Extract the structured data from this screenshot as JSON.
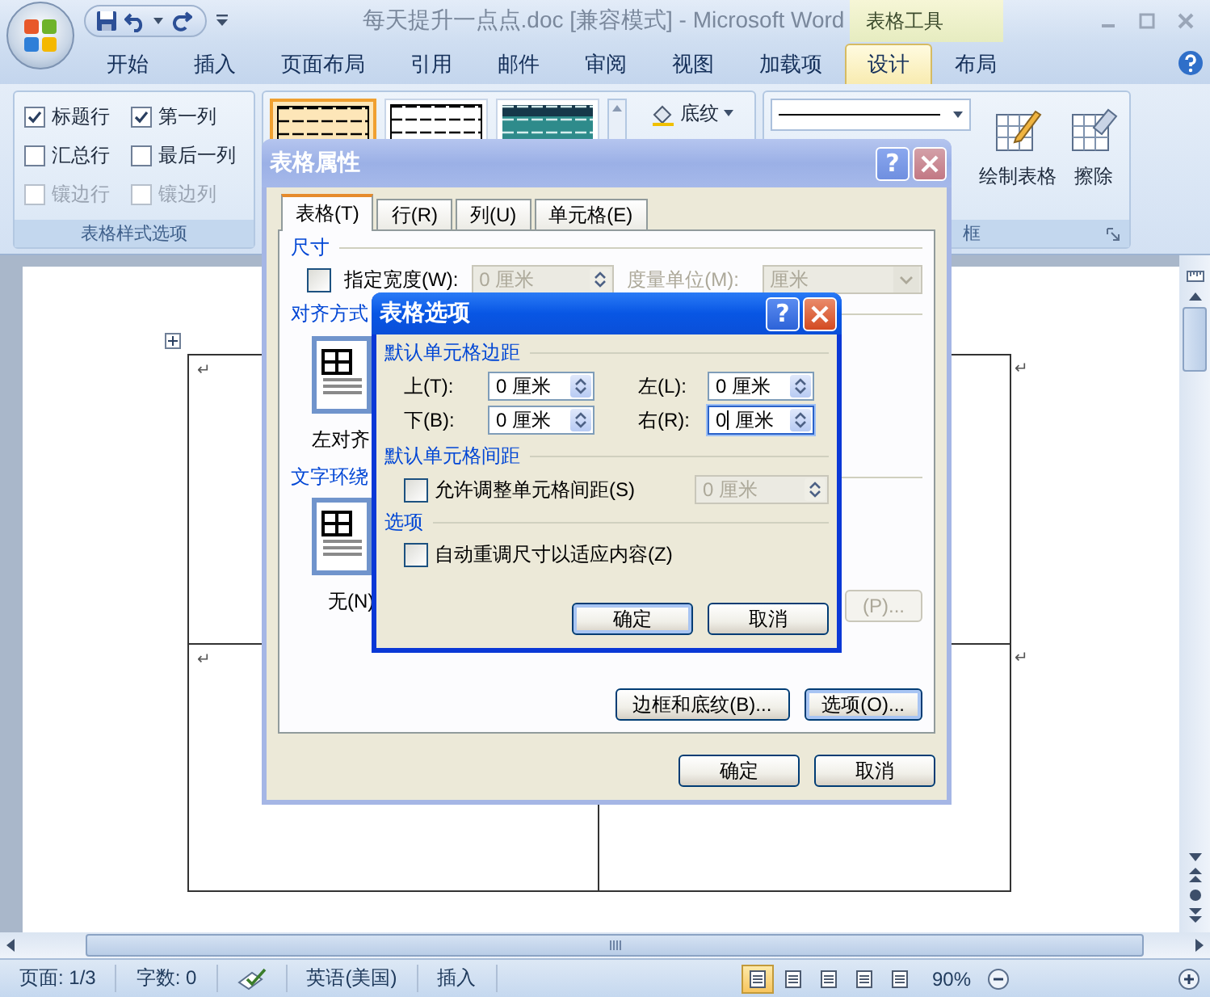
{
  "window": {
    "title": "每天提升一点点.doc [兼容模式] - Microsoft Word",
    "context_tab_group": "表格工具"
  },
  "ribbon_tabs": [
    {
      "label": "开始",
      "selected": false
    },
    {
      "label": "插入",
      "selected": false
    },
    {
      "label": "页面布局",
      "selected": false
    },
    {
      "label": "引用",
      "selected": false
    },
    {
      "label": "邮件",
      "selected": false
    },
    {
      "label": "审阅",
      "selected": false
    },
    {
      "label": "视图",
      "selected": false
    },
    {
      "label": "加载项",
      "selected": false
    },
    {
      "label": "设计",
      "selected": true
    },
    {
      "label": "布局",
      "selected": false
    }
  ],
  "ribbon": {
    "style_options": {
      "checkboxes": [
        {
          "label": "标题行",
          "checked": true,
          "disabled": false
        },
        {
          "label": "第一列",
          "checked": true,
          "disabled": false
        },
        {
          "label": "汇总行",
          "checked": false,
          "disabled": false
        },
        {
          "label": "最后一列",
          "checked": false,
          "disabled": false
        },
        {
          "label": "镶边行",
          "checked": false,
          "disabled": true
        },
        {
          "label": "镶边列",
          "checked": false,
          "disabled": true
        }
      ],
      "group_label": "表格样式选项"
    },
    "table_styles": [
      {
        "kind": "plain",
        "selected": true
      },
      {
        "kind": "plain",
        "selected": false
      },
      {
        "kind": "shaded",
        "selected": false
      }
    ],
    "shading_button": "底纹",
    "draw_table_button": "绘制表格",
    "eraser_button": "擦除",
    "borders_group_label": "框"
  },
  "document": {
    "rows": [
      {
        "cell_mark": "↵",
        "row_end_mark": "↵"
      },
      {
        "cell_mark": "↵",
        "row_end_mark": "↵"
      }
    ]
  },
  "status_bar": {
    "page": "页面: 1/3",
    "words": "字数: 0",
    "language": "英语(美国)",
    "mode": "插入",
    "zoom": "90%"
  },
  "table_properties": {
    "title": "表格属性",
    "help_button": "?",
    "tabs": [
      {
        "label": "表格(T)",
        "selected": true
      },
      {
        "label": "行(R)",
        "selected": false
      },
      {
        "label": "列(U)",
        "selected": false
      },
      {
        "label": "单元格(E)",
        "selected": false
      }
    ],
    "size_section": "尺寸",
    "width_checkbox": {
      "label": "指定宽度(W):",
      "checked": false
    },
    "width_field": {
      "value": "0 厘米",
      "disabled": true
    },
    "unit_label": "度量单位(M):",
    "unit_field": {
      "value": "厘米",
      "disabled": true
    },
    "alignment_section": "对齐方式",
    "alignment_option": "左对齐",
    "wrap_section": "文字环绕",
    "wrap_option": "无(N)",
    "position_button": "(P)...",
    "borders_button": "边框和底纹(B)...",
    "options_button": "选项(O)...",
    "ok_button": "确定",
    "cancel_button": "取消"
  },
  "table_options": {
    "title": "表格选项",
    "help_button": "?",
    "margins_section": "默认单元格边距",
    "margins": [
      {
        "label": "上(T):",
        "value": "0 厘米",
        "focused": false
      },
      {
        "label": "左(L):",
        "value": "0 厘米",
        "focused": false
      },
      {
        "label": "下(B):",
        "value": "0 厘米",
        "focused": false
      },
      {
        "label": "右(R):",
        "value": "0 厘米",
        "focused": true
      }
    ],
    "spacing_section": "默认单元格间距",
    "spacing_checkbox": {
      "label": "允许调整单元格间距(S)",
      "checked": false
    },
    "spacing_field": {
      "value": "0 厘米",
      "disabled": true
    },
    "options_section": "选项",
    "autofit_checkbox": {
      "label": "自动重调尺寸以适应内容(Z)",
      "checked": false
    },
    "ok_button": "确定",
    "cancel_button": "取消"
  }
}
